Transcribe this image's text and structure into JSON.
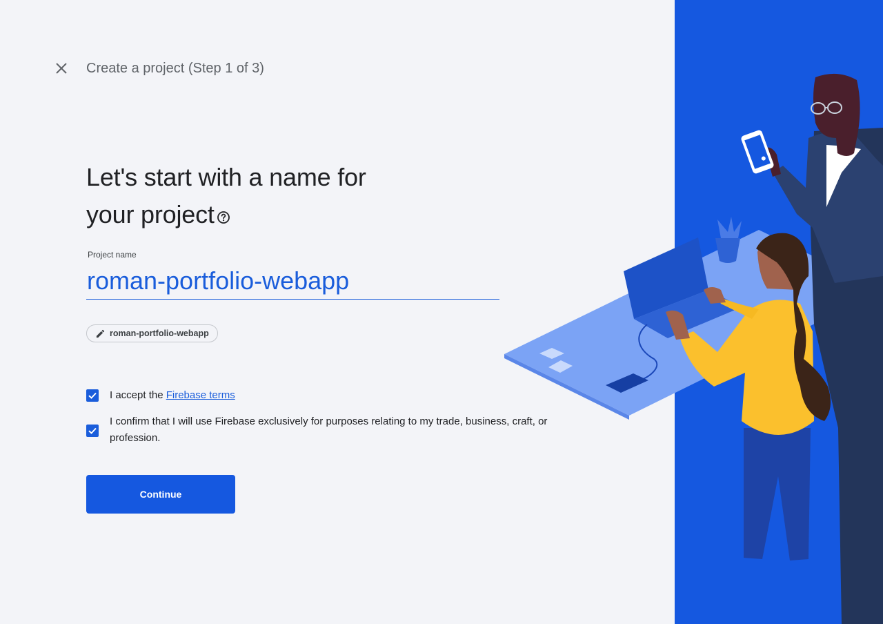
{
  "header": {
    "step_title": "Create a project (Step 1 of 3)"
  },
  "main": {
    "headline_line1": "Let's start with a name for",
    "headline_line2": "your project",
    "project_name_label": "Project name",
    "project_name_value": "roman-portfolio-webapp",
    "project_id_chip": "roman-portfolio-webapp",
    "terms_prefix": "I accept the ",
    "terms_link": "Firebase terms",
    "terms_checked": true,
    "confirm_text": "I confirm that I will use Firebase exclusively for purposes relating to my trade, business, craft, or profession.",
    "confirm_checked": true,
    "continue_label": "Continue"
  },
  "icons": {
    "close": "close-icon",
    "help": "help-circle-icon",
    "edit": "pencil-icon",
    "check": "check-icon"
  },
  "colors": {
    "accent": "#1a5ddb",
    "illustration_bg": "#1558e0",
    "page_bg": "#f3f4f8"
  }
}
